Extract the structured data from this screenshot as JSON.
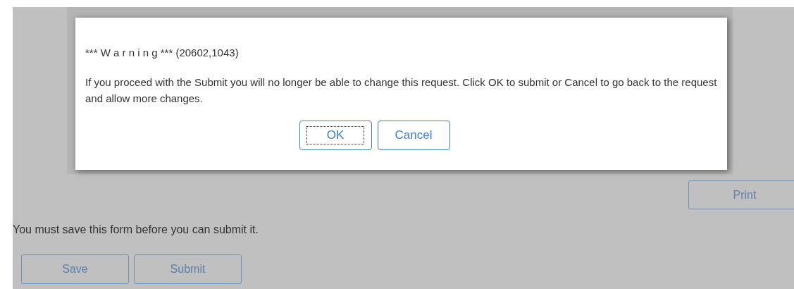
{
  "dialog": {
    "heading": "*** W a r n i n g *** (20602,1043)",
    "message": "If you proceed with the Submit you will no longer be able to change this request.  Click OK to submit or Cancel to go back to the request and allow more changes.",
    "buttons": [
      {
        "label": "OK",
        "focused": true
      },
      {
        "label": "Cancel",
        "focused": false
      }
    ]
  },
  "print_button": "Print",
  "notice": "You must save this form before you can submit it.",
  "buttons": [
    "Save",
    "Submit"
  ]
}
